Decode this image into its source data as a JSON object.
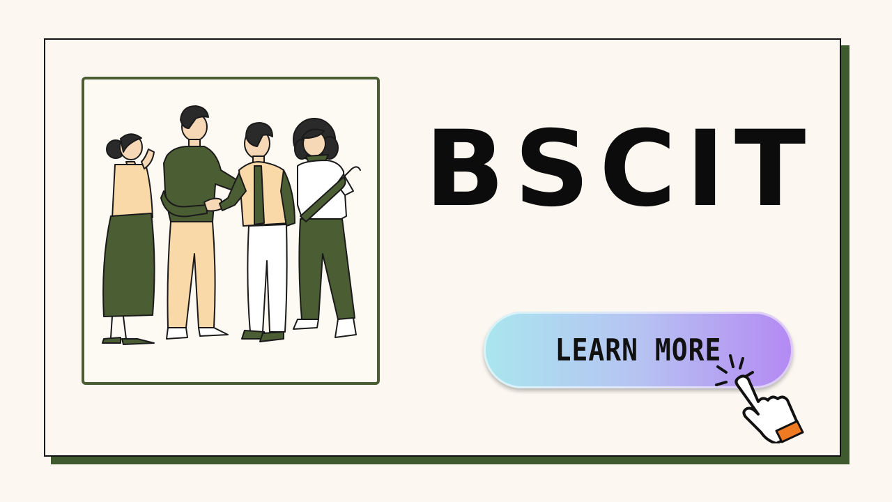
{
  "headline": "BSCIT",
  "cta": {
    "label": "LEARN MORE"
  },
  "icons": {
    "illustration": "team-handshake-illustration",
    "pointer": "hand-pointer-icon"
  },
  "colors": {
    "background": "#fcf7f1",
    "accent_green": "#4b5e33",
    "shadow_green": "#3f5a2e",
    "text": "#0c0c0c",
    "button_gradient_start": "#a9e6ee",
    "button_gradient_end": "#b489f3",
    "cuff_orange": "#ee7a21"
  }
}
